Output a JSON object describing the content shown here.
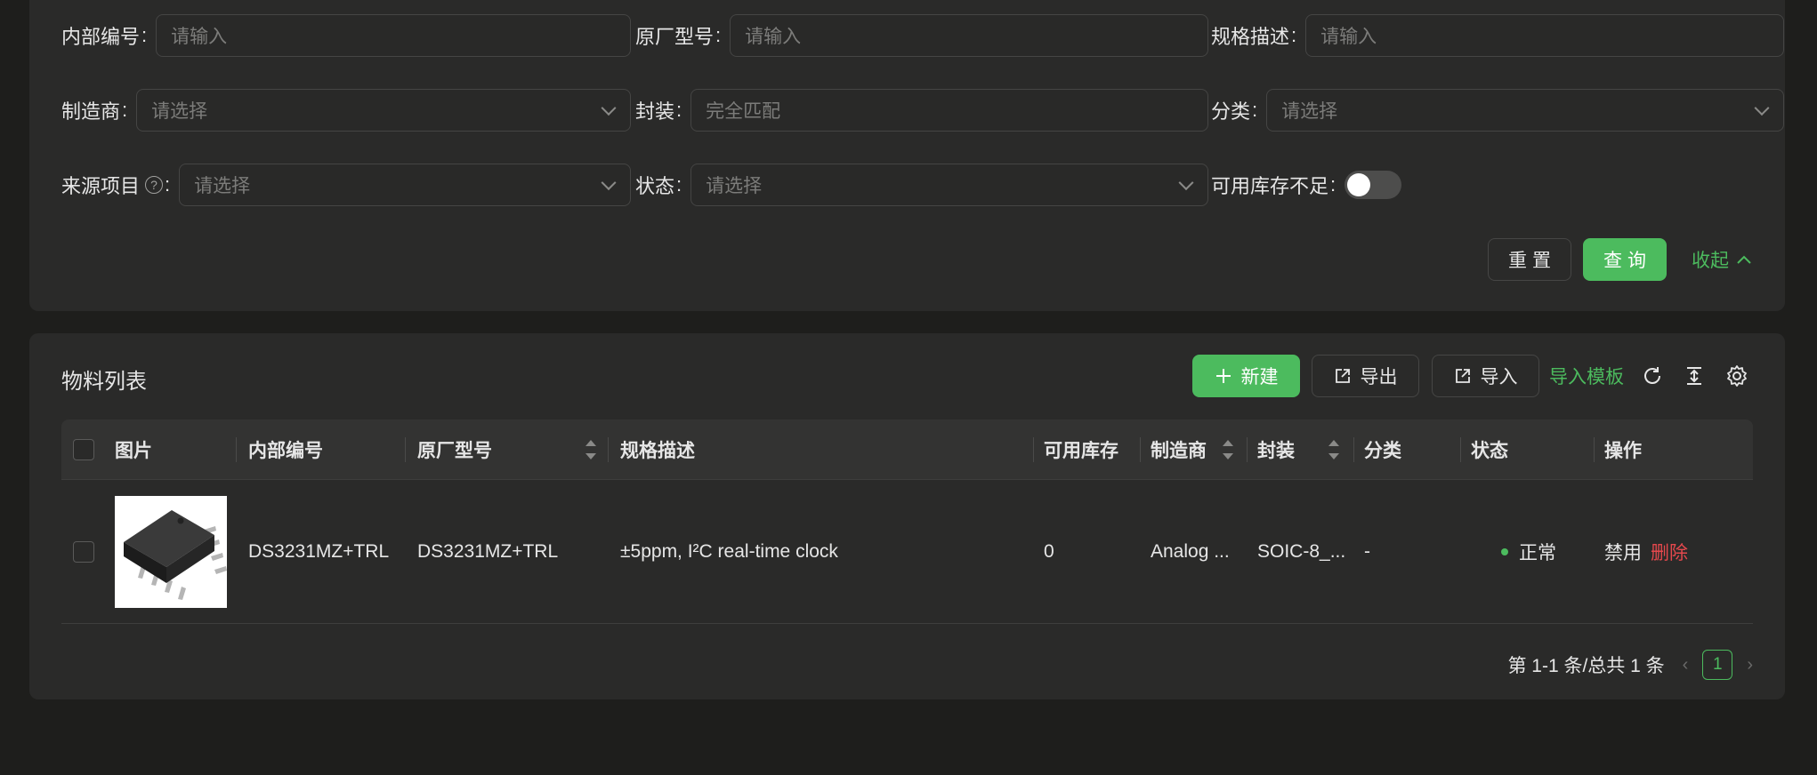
{
  "filter": {
    "fields": [
      {
        "label": "内部编号",
        "placeholder": "请输入"
      },
      {
        "label": "原厂型号",
        "placeholder": "请输入"
      },
      {
        "label": "规格描述",
        "placeholder": "请输入"
      },
      {
        "label": "制造商",
        "placeholder": "请选择"
      },
      {
        "label": "封装",
        "placeholder": "完全匹配"
      },
      {
        "label": "分类",
        "placeholder": "请选择"
      },
      {
        "label": "来源项目",
        "placeholder": "请选择"
      },
      {
        "label": "状态",
        "placeholder": "请选择"
      },
      {
        "label": "可用库存不足"
      }
    ],
    "colon": ":",
    "help_glyph": "?",
    "toggle_on": false,
    "reset_label": "重置",
    "query_label": "查询",
    "collapse_label": "收起"
  },
  "list": {
    "title": "物料列表",
    "new_label": "新建",
    "export_label": "导出",
    "import_label": "导入",
    "template_label": "导入模板",
    "columns": [
      "图片",
      "内部编号",
      "原厂型号",
      "规格描述",
      "可用库存",
      "制造商",
      "封装",
      "分类",
      "状态",
      "操作"
    ],
    "rows": [
      {
        "internal_no": "DS3231MZ+TRL",
        "model": "DS3231MZ+TRL",
        "spec": "±5ppm, I²C real-time clock",
        "stock": "0",
        "manufacturer": "Analog ...",
        "package": "SOIC-8_...",
        "category": "-",
        "status": "正常",
        "action_disable": "禁用",
        "action_delete": "删除"
      }
    ],
    "pagination": {
      "summary": "第 1-1 条/总共 1 条",
      "current_page": "1",
      "prev": "‹",
      "next": "›"
    }
  },
  "colors": {
    "accent": "#4cbb5e",
    "danger": "#e5484d",
    "background": "#1e1e1c",
    "card": "#2a2a29"
  }
}
